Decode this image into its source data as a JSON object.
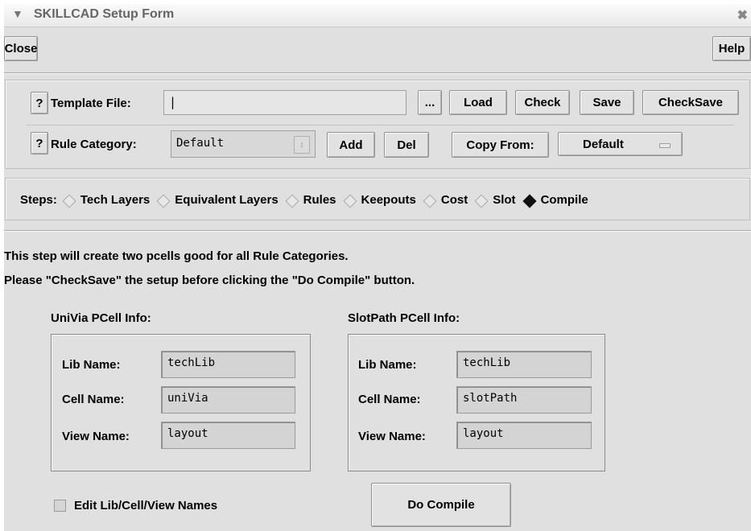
{
  "window": {
    "title": "SKILLCAD Setup Form"
  },
  "toolbar": {
    "close_label": "Close",
    "help_label": "Help"
  },
  "template": {
    "help_label": "?",
    "label": "Template File:",
    "value": "",
    "browse_label": "...",
    "load_label": "Load",
    "check_label": "Check",
    "save_label": "Save",
    "checksave_label": "CheckSave"
  },
  "rule": {
    "help_label": "?",
    "label": "Rule Category:",
    "value": "Default",
    "add_label": "Add",
    "del_label": "Del",
    "copy_from_label": "Copy From:",
    "copy_from_value": "Default"
  },
  "steps": {
    "label": "Steps:",
    "items": [
      {
        "label": "Tech Layers",
        "selected": false
      },
      {
        "label": "Equivalent Layers",
        "selected": false
      },
      {
        "label": "Rules",
        "selected": false
      },
      {
        "label": "Keepouts",
        "selected": false
      },
      {
        "label": "Cost",
        "selected": false
      },
      {
        "label": "Slot",
        "selected": false
      },
      {
        "label": "Compile",
        "selected": true
      }
    ]
  },
  "description": {
    "line1": "This step will create two pcells good for all Rule Categories.",
    "line2": "Please \"CheckSave\" the setup before clicking the \"Do Compile\" button."
  },
  "univia": {
    "title": "UniVia PCell Info:",
    "lib_label": "Lib Name:",
    "lib_value": "techLib",
    "cell_label": "Cell Name:",
    "cell_value": "uniVia",
    "view_label": "View Name:",
    "view_value": "layout"
  },
  "slotpath": {
    "title": "SlotPath PCell Info:",
    "lib_label": "Lib Name:",
    "lib_value": "techLib",
    "cell_label": "Cell Name:",
    "cell_value": "slotPath",
    "view_label": "View Name:",
    "view_value": "layout"
  },
  "footer": {
    "edit_names_label": "Edit Lib/Cell/View Names",
    "edit_names_checked": false,
    "do_compile_label": "Do Compile"
  }
}
